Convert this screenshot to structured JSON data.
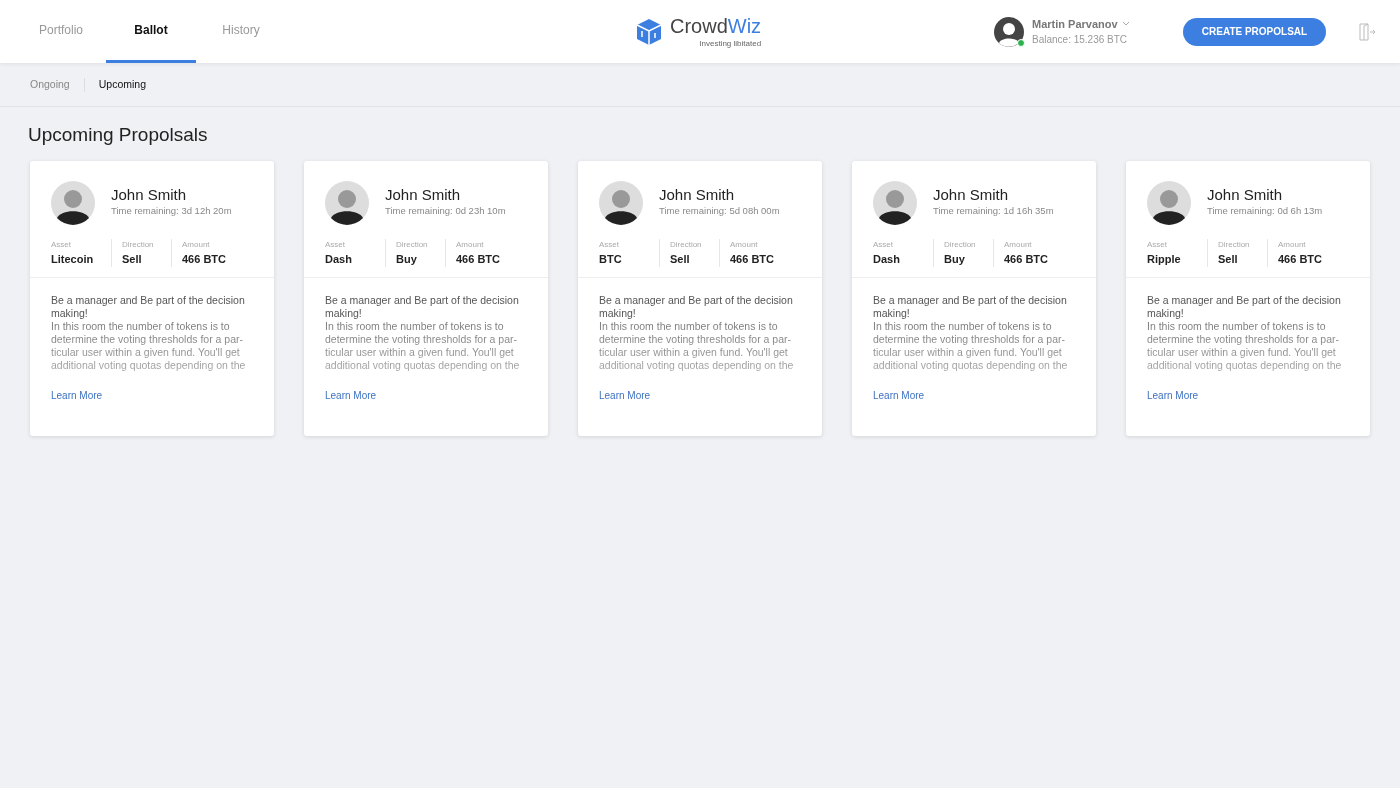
{
  "nav": {
    "tabs": [
      {
        "label": "Portfolio",
        "selected": false
      },
      {
        "label": "Ballot",
        "selected": true
      },
      {
        "label": "History",
        "selected": false
      }
    ]
  },
  "logo": {
    "name_a": "Crowd",
    "name_b": "Wiz",
    "tagline": "Investing libitated"
  },
  "user": {
    "name": "Martin Parvanov",
    "balance": "Balance: 15.236 BTC",
    "online": true
  },
  "create_button": "CREATE PROPOLSAL",
  "subnav": [
    {
      "label": "Ongoing",
      "selected": false
    },
    {
      "label": "Upcoming",
      "selected": true
    }
  ],
  "heading": "Upcoming Propolsals",
  "proposals": [
    {
      "name": "John Smith",
      "time": "Time remaining: 3d 12h 20m",
      "fields": [
        {
          "label": "Asset",
          "value": "Litecoin"
        },
        {
          "label": "Direction",
          "value": "Sell"
        },
        {
          "label": "Amount",
          "value": "466 BTC"
        }
      ],
      "lead": "Be a manager and Be part of the decision making!",
      "body": "In this room the number of tokens is to determine the voting thresholds for a par-ticular user within a given fund. You'll get additional voting quotas depending on the",
      "link": "Learn More"
    },
    {
      "name": "John Smith",
      "time": "Time remaining: 0d 23h 10m",
      "fields": [
        {
          "label": "Asset",
          "value": "Dash"
        },
        {
          "label": "Direction",
          "value": "Buy"
        },
        {
          "label": "Amount",
          "value": "466 BTC"
        }
      ],
      "lead": "Be a manager and Be part of the decision making!",
      "body": "In this room the number of tokens is to determine the voting thresholds for a par-ticular user within a given fund. You'll get additional voting quotas depending on the",
      "link": "Learn More"
    },
    {
      "name": "John Smith",
      "time": "Time remaining: 5d 08h 00m",
      "fields": [
        {
          "label": "Asset",
          "value": "BTC"
        },
        {
          "label": "Direction",
          "value": "Sell"
        },
        {
          "label": "Amount",
          "value": "466 BTC"
        }
      ],
      "lead": "Be a manager and Be part of the decision making!",
      "body": "In this room the number of tokens is to determine the voting thresholds for a par-ticular user within a given fund. You'll get additional voting quotas depending on the",
      "link": "Learn More"
    },
    {
      "name": "John Smith",
      "time": "Time remaining: 1d 16h 35m",
      "fields": [
        {
          "label": "Asset",
          "value": "Dash"
        },
        {
          "label": "Direction",
          "value": "Buy"
        },
        {
          "label": "Amount",
          "value": "466 BTC"
        }
      ],
      "lead": "Be a manager and Be part of the decision making!",
      "body": "In this room the number of tokens is to determine the voting thresholds for a par-ticular user within a given fund. You'll get additional voting quotas depending on the",
      "link": "Learn More"
    },
    {
      "name": "John Smith",
      "time": "Time remaining: 0d 6h 13m",
      "fields": [
        {
          "label": "Asset",
          "value": "Ripple"
        },
        {
          "label": "Direction",
          "value": "Sell"
        },
        {
          "label": "Amount",
          "value": "466 BTC"
        }
      ],
      "lead": "Be a manager and Be part of the decision making!",
      "body": "In this room the number of tokens is to determine the voting thresholds for a par-ticular user within a given fund. You'll get additional voting quotas depending on the",
      "link": "Learn More"
    }
  ]
}
